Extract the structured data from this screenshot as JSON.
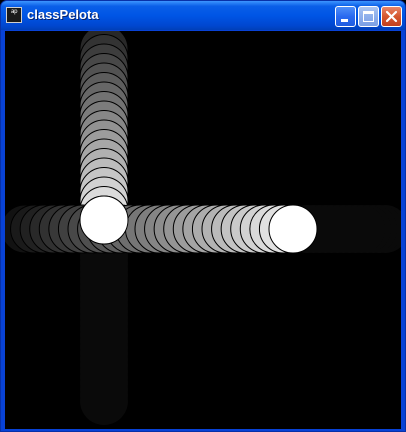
{
  "window": {
    "title": "classPelota",
    "icon": "processing-app-icon",
    "icon_text": "ap",
    "buttons": {
      "minimize": "minimize-icon",
      "maximize": "maximize-icon",
      "close": "close-icon"
    }
  },
  "colors": {
    "titlebar": "#0055e5",
    "frame": "#0842d6",
    "canvas_background": "#000000",
    "ball_fill": "#ffffff",
    "ball_stroke": "#000000"
  },
  "sketch": {
    "ball_count": 2,
    "trail_length": 40
  }
}
